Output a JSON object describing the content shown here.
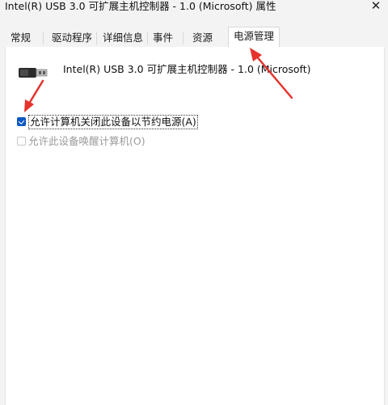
{
  "window": {
    "title": "Intel(R) USB 3.0 可扩展主机控制器 - 1.0 (Microsoft) 属性",
    "close_glyph": "✕"
  },
  "tabs": [
    {
      "label": "常规",
      "active": false
    },
    {
      "label": "驱动程序",
      "active": false
    },
    {
      "label": "详细信息",
      "active": false
    },
    {
      "label": "事件",
      "active": false
    },
    {
      "label": "资源",
      "active": false
    },
    {
      "label": "电源管理",
      "active": true
    }
  ],
  "device": {
    "icon": "usb-plug-icon",
    "name": "Intel(R) USB 3.0 可扩展主机控制器 - 1.0 (Microsoft)"
  },
  "options": [
    {
      "label": "允许计算机关闭此设备以节约电源(A)",
      "checked": true,
      "enabled": true
    },
    {
      "label": "允许此设备唤醒计算机(O)",
      "checked": false,
      "enabled": false
    }
  ],
  "colors": {
    "annotation_arrow": "#e5322d",
    "checkbox_accent": "#0a58c2"
  }
}
